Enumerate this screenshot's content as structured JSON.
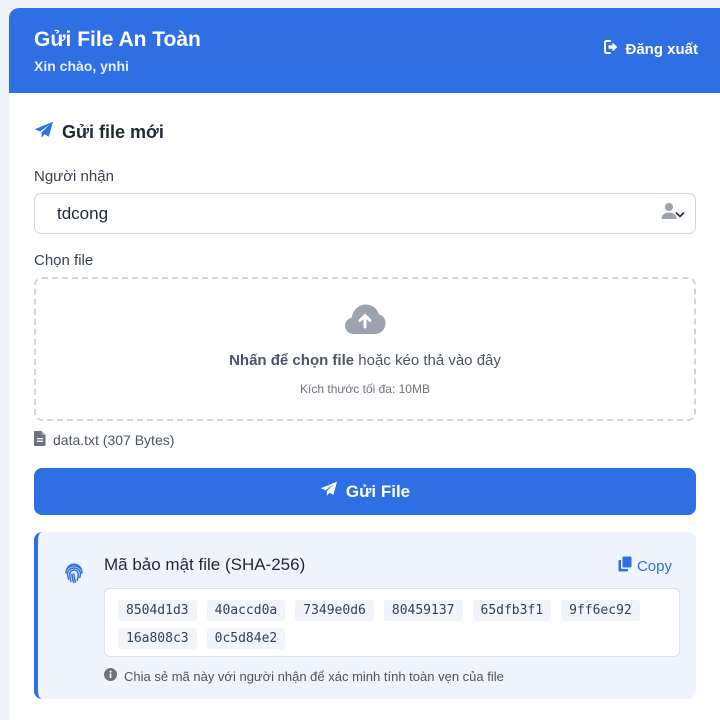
{
  "header": {
    "title": "Gửi File An Toàn",
    "greeting": "Xin chào, ynhi",
    "logout_label": "Đăng xuất"
  },
  "form": {
    "section_title": "Gửi file mới",
    "recipient_label": "Người nhận",
    "recipient_value": "tdcong",
    "file_label": "Chọn file",
    "dropzone_bold": "Nhấn để chọn file",
    "dropzone_rest": " hoặc kéo thả vào đây",
    "dropzone_hint": "Kích thước tối đa: 10MB",
    "selected_file": "data.txt (307 Bytes)",
    "send_label": "Gửi File"
  },
  "hash": {
    "title": "Mã bảo mật file (SHA-256)",
    "copy_label": "Copy",
    "chunks": [
      "8504d1d3",
      "40accd0a",
      "7349e0d6",
      "80459137",
      "65dfb3f1",
      "9ff6ec92",
      "16a808c3",
      "0c5d84e2"
    ],
    "note": "Chia sẻ mã này với người nhận để xác minh tính toàn vẹn của file"
  },
  "colors": {
    "primary": "#2f6fe4",
    "background": "#eef1f6",
    "hash_panel": "#eef3fd"
  },
  "icons": [
    "logout-icon",
    "paper-plane-icon",
    "user-icon",
    "chevron-down-icon",
    "cloud-upload-icon",
    "file-icon",
    "fingerprint-icon",
    "copy-icon",
    "info-icon"
  ]
}
